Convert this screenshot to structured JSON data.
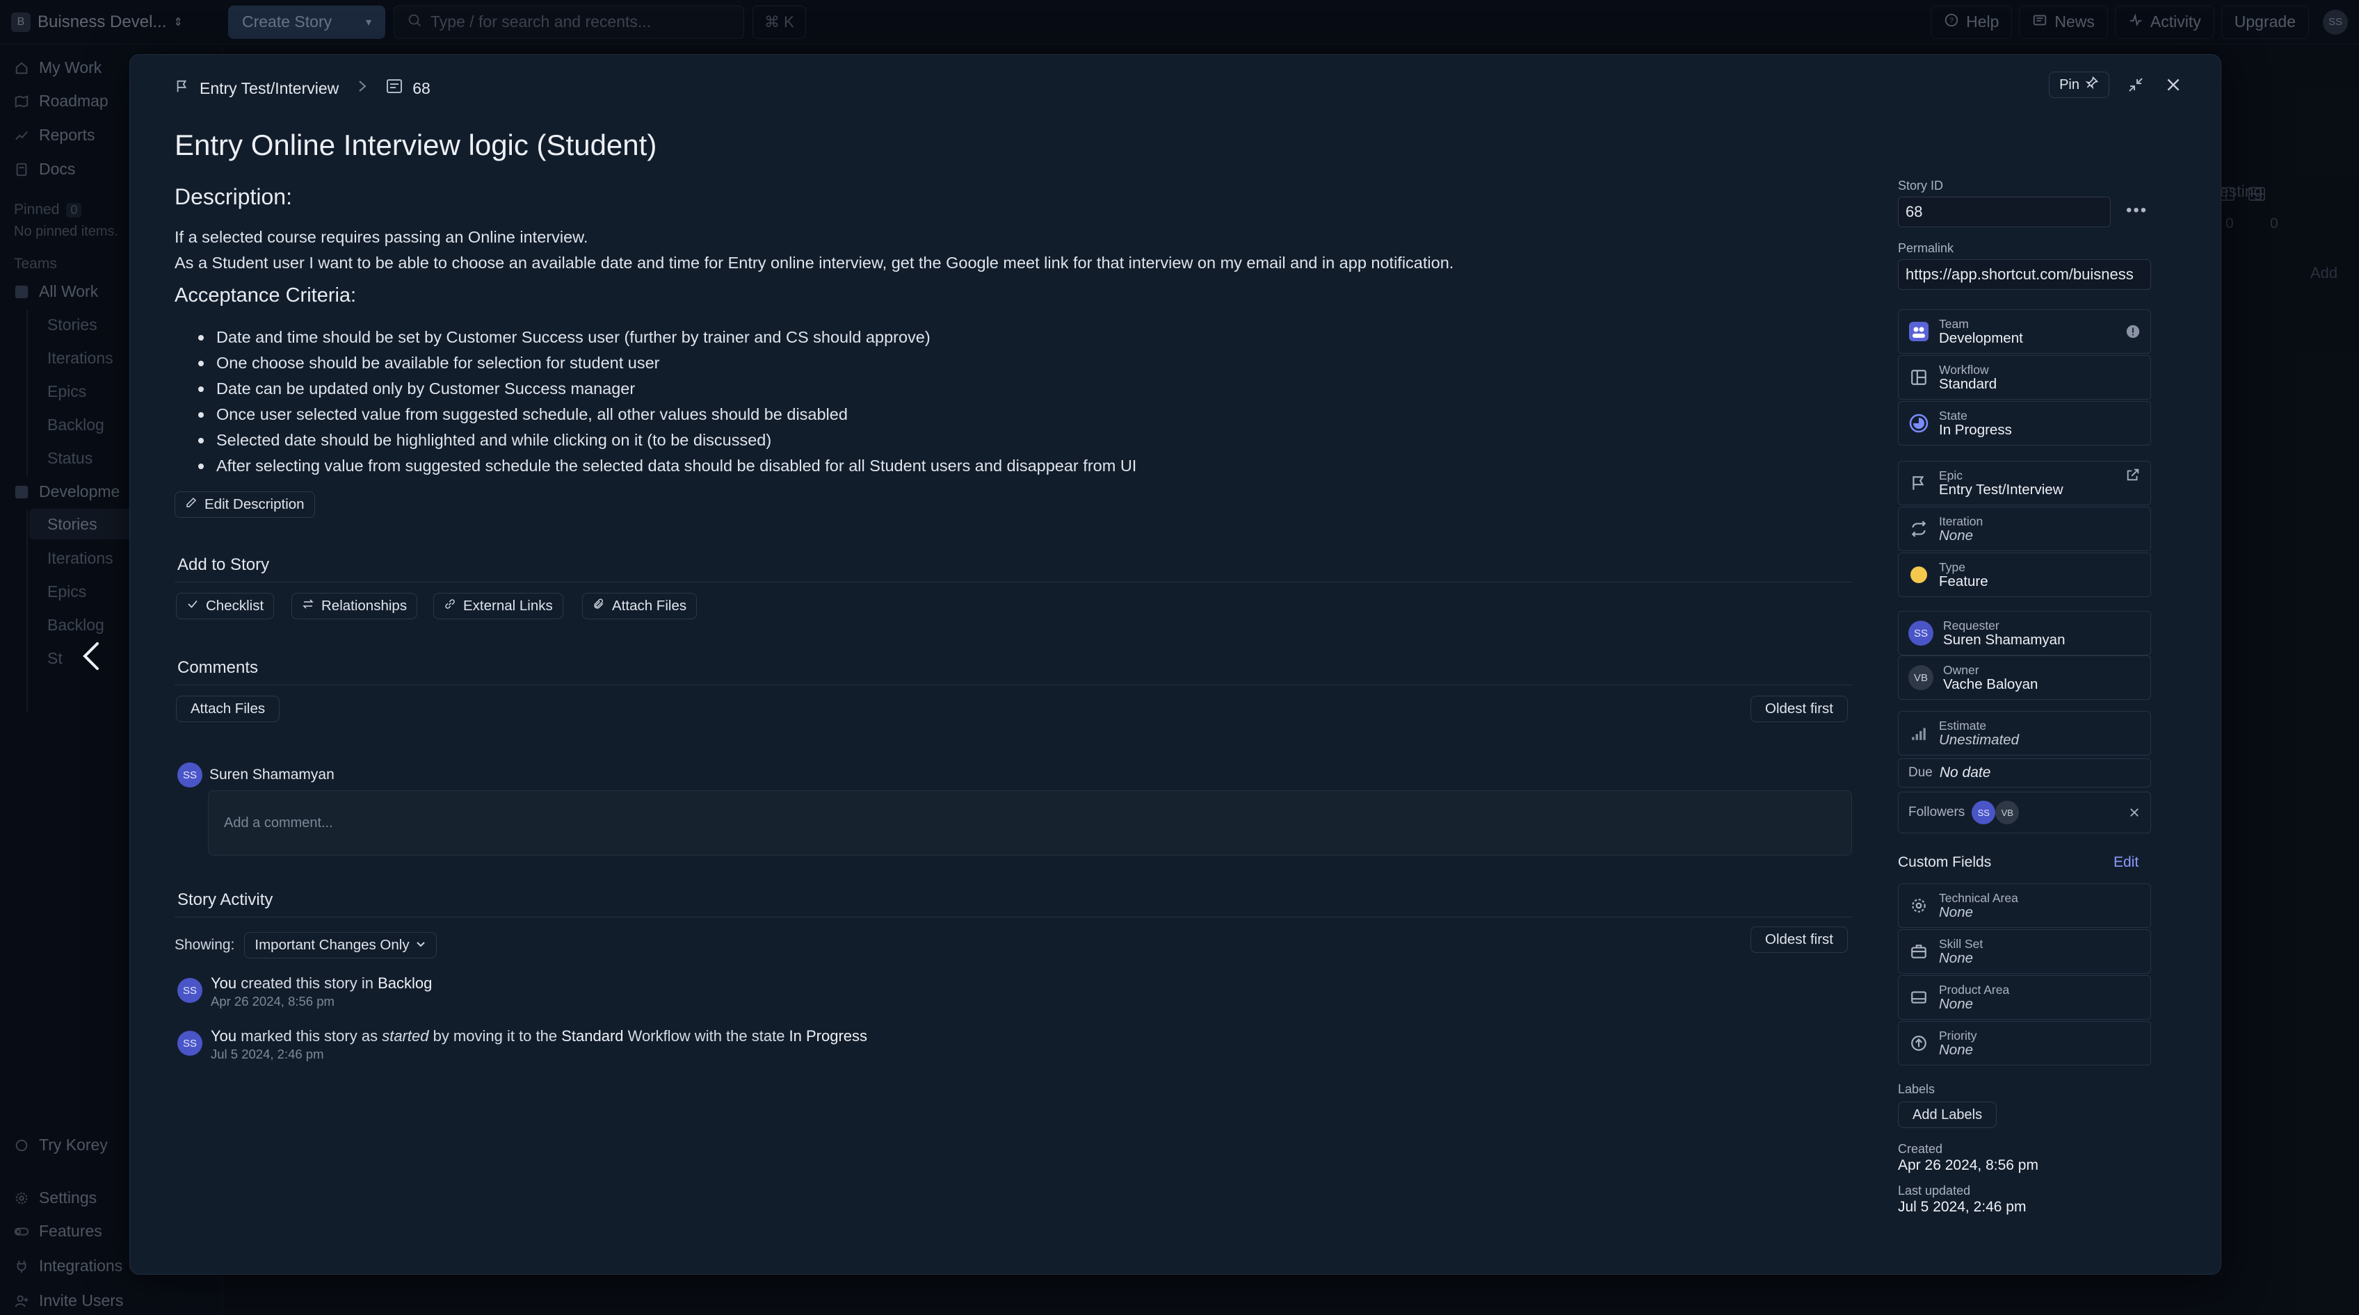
{
  "topbar": {
    "workspace": "Buisness Devel...",
    "create_story": "Create Story",
    "search_placeholder": "Type / for search and recents...",
    "shortcut": "⌘ K",
    "help": "Help",
    "news": "News",
    "activity": "Activity",
    "upgrade": "Upgrade",
    "avatar": "SS"
  },
  "sidebar": {
    "my_work": "My Work",
    "roadmap": "Roadmap",
    "reports": "Reports",
    "docs": "Docs",
    "pinned_label": "Pinned",
    "pinned_count": "0",
    "no_pinned": "No pinned items.",
    "teams_label": "Teams",
    "all_work": "All Work",
    "all_work_items": [
      "Stories",
      "Iterations",
      "Epics",
      "Backlog",
      "Status"
    ],
    "development": "Developme",
    "development_items": [
      "Stories",
      "Iterations",
      "Epics",
      "Backlog",
      "St"
    ],
    "try_korey": "Try Korey",
    "settings": "Settings",
    "features": "Features",
    "integrations": "Integrations",
    "invite_users": "Invite Users"
  },
  "background": {
    "column_title": "esting",
    "count_a": "0",
    "count_b": "0",
    "add": "Add"
  },
  "modal": {
    "breadcrumb_epic": "Entry Test/Interview",
    "breadcrumb_id": "68",
    "pin": "Pin",
    "title": "Entry Online Interview logic (Student)",
    "description_heading": "Description:",
    "description_lines": [
      "If a selected course requires passing an Online interview.",
      "As a Student user I want to be able to choose an available date and time for Entry online interview, get the Google meet link for that interview on my email and in app notification."
    ],
    "acceptance_heading": "Acceptance Criteria:",
    "criteria": [
      "Date and time should be set by Customer Success user (further by trainer and CS should approve)",
      "One choose should be available for selection for student user",
      "Date can be updated only by Customer Success manager",
      "Once user selected value from suggested schedule, all other values should be disabled",
      "Selected date should be highlighted and while clicking on it (to be discussed)",
      "After selecting value from suggested schedule the selected data should be disabled for all Student users and disappear from UI"
    ],
    "edit_description": "Edit Description",
    "add_to_story": "Add to Story",
    "add_buttons": [
      "Checklist",
      "Relationships",
      "External Links",
      "Attach Files"
    ],
    "comments_heading": "Comments",
    "attach_files": "Attach Files",
    "oldest_first": "Oldest first",
    "comment_author_initials": "SS",
    "comment_author": "Suren Shamamyan",
    "comment_placeholder": "Add a comment...",
    "activity_heading": "Story Activity",
    "showing_label": "Showing:",
    "showing_value": "Important Changes Only",
    "activity_oldest_first": "Oldest first",
    "activities": [
      {
        "initials": "SS",
        "you": "You",
        "text1": " created this story in ",
        "target": "Backlog",
        "time": "Apr 26 2024, 8:56 pm"
      },
      {
        "initials": "SS",
        "you": "You",
        "text1": " marked this story as ",
        "em": "started",
        "text2": " by moving it to the ",
        "workflow": "Standard",
        "text3": " Workflow with the state ",
        "state": "In Progress",
        "time": "Jul 5 2024, 2:46 pm"
      }
    ]
  },
  "panel": {
    "story_id_label": "Story ID",
    "story_id": "68",
    "permalink_label": "Permalink",
    "permalink": "https://app.shortcut.com/buisness",
    "team_label": "Team",
    "team": "Development",
    "workflow_label": "Workflow",
    "workflow": "Standard",
    "state_label": "State",
    "state": "In Progress",
    "epic_label": "Epic",
    "epic": "Entry Test/Interview",
    "iteration_label": "Iteration",
    "iteration": "None",
    "type_label": "Type",
    "type": "Feature",
    "requester_label": "Requester",
    "requester_initials": "SS",
    "requester": "Suren Shamamyan",
    "owner_label": "Owner",
    "owner_initials": "VB",
    "owner": "Vache Baloyan",
    "estimate_label": "Estimate",
    "estimate": "Unestimated",
    "due_label": "Due",
    "due": "No date",
    "followers_label": "Followers",
    "follower_1": "SS",
    "follower_2": "VB",
    "custom_fields": "Custom Fields",
    "edit": "Edit",
    "technical_area_label": "Technical Area",
    "technical_area": "None",
    "skill_set_label": "Skill Set",
    "skill_set": "None",
    "product_area_label": "Product Area",
    "product_area": "None",
    "priority_label": "Priority",
    "priority": "None",
    "labels_label": "Labels",
    "add_labels": "Add Labels",
    "created_label": "Created",
    "created": "Apr 26 2024, 8:56 pm",
    "updated_label": "Last updated",
    "updated": "Jul 5 2024, 2:46 pm"
  },
  "colors": {
    "modal_bg": "#121d2c",
    "accent_avatar": "#4a55c8",
    "type_feature": "#f2c94c",
    "state_in_progress": "#7b8cff"
  }
}
